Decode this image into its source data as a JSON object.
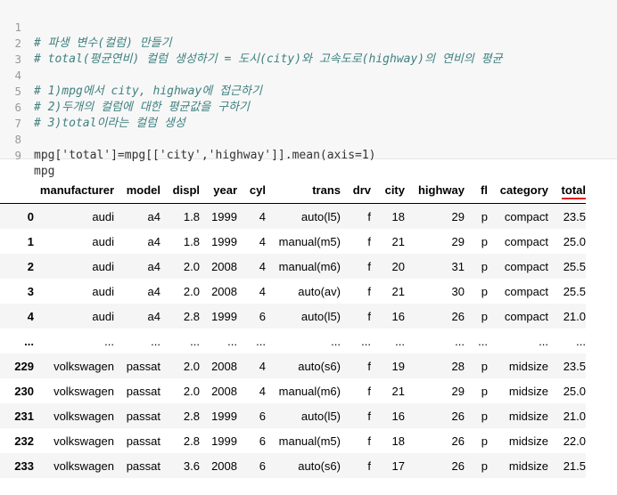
{
  "code": {
    "lines": [
      {
        "num": "1",
        "text": "# 파생 변수(컬럼) 만들기"
      },
      {
        "num": "2",
        "text": "# total(평균연비) 컬럼 생성하기 = 도시(city)와 고속도로(highway)의 연비의 평균"
      },
      {
        "num": "3",
        "text": ""
      },
      {
        "num": "4",
        "text": "# 1)mpg에서 city, highway에 접근하기"
      },
      {
        "num": "5",
        "text": "# 2)두개의 컬럼에 대한 평균값을 구하기"
      },
      {
        "num": "6",
        "text": "# 3)total이라는 컬럼 생성"
      },
      {
        "num": "7",
        "text": ""
      },
      {
        "num": "8",
        "text": "mpg['total']=mpg[['city','highway']].mean(axis=1)"
      },
      {
        "num": "9",
        "text": "mpg"
      }
    ]
  },
  "table": {
    "columns": [
      "manufacturer",
      "model",
      "displ",
      "year",
      "cyl",
      "trans",
      "drv",
      "city",
      "highway",
      "fl",
      "category",
      "total"
    ],
    "rows": [
      {
        "index": "0",
        "cells": [
          "audi",
          "a4",
          "1.8",
          "1999",
          "4",
          "auto(l5)",
          "f",
          "18",
          "29",
          "p",
          "compact",
          "23.5"
        ]
      },
      {
        "index": "1",
        "cells": [
          "audi",
          "a4",
          "1.8",
          "1999",
          "4",
          "manual(m5)",
          "f",
          "21",
          "29",
          "p",
          "compact",
          "25.0"
        ]
      },
      {
        "index": "2",
        "cells": [
          "audi",
          "a4",
          "2.0",
          "2008",
          "4",
          "manual(m6)",
          "f",
          "20",
          "31",
          "p",
          "compact",
          "25.5"
        ]
      },
      {
        "index": "3",
        "cells": [
          "audi",
          "a4",
          "2.0",
          "2008",
          "4",
          "auto(av)",
          "f",
          "21",
          "30",
          "p",
          "compact",
          "25.5"
        ]
      },
      {
        "index": "4",
        "cells": [
          "audi",
          "a4",
          "2.8",
          "1999",
          "6",
          "auto(l5)",
          "f",
          "16",
          "26",
          "p",
          "compact",
          "21.0"
        ]
      },
      {
        "index": "...",
        "cells": [
          "...",
          "...",
          "...",
          "...",
          "...",
          "...",
          "...",
          "...",
          "...",
          "...",
          "...",
          "..."
        ]
      },
      {
        "index": "229",
        "cells": [
          "volkswagen",
          "passat",
          "2.0",
          "2008",
          "4",
          "auto(s6)",
          "f",
          "19",
          "28",
          "p",
          "midsize",
          "23.5"
        ]
      },
      {
        "index": "230",
        "cells": [
          "volkswagen",
          "passat",
          "2.0",
          "2008",
          "4",
          "manual(m6)",
          "f",
          "21",
          "29",
          "p",
          "midsize",
          "25.0"
        ]
      },
      {
        "index": "231",
        "cells": [
          "volkswagen",
          "passat",
          "2.8",
          "1999",
          "6",
          "auto(l5)",
          "f",
          "16",
          "26",
          "p",
          "midsize",
          "21.0"
        ]
      },
      {
        "index": "232",
        "cells": [
          "volkswagen",
          "passat",
          "2.8",
          "1999",
          "6",
          "manual(m5)",
          "f",
          "18",
          "26",
          "p",
          "midsize",
          "22.0"
        ]
      },
      {
        "index": "233",
        "cells": [
          "volkswagen",
          "passat",
          "3.6",
          "2008",
          "6",
          "auto(s6)",
          "f",
          "17",
          "26",
          "p",
          "midsize",
          "21.5"
        ]
      }
    ]
  },
  "colors": {
    "highlight_underline": "#e02020",
    "comment": "#408080",
    "string": "#ba2121"
  }
}
